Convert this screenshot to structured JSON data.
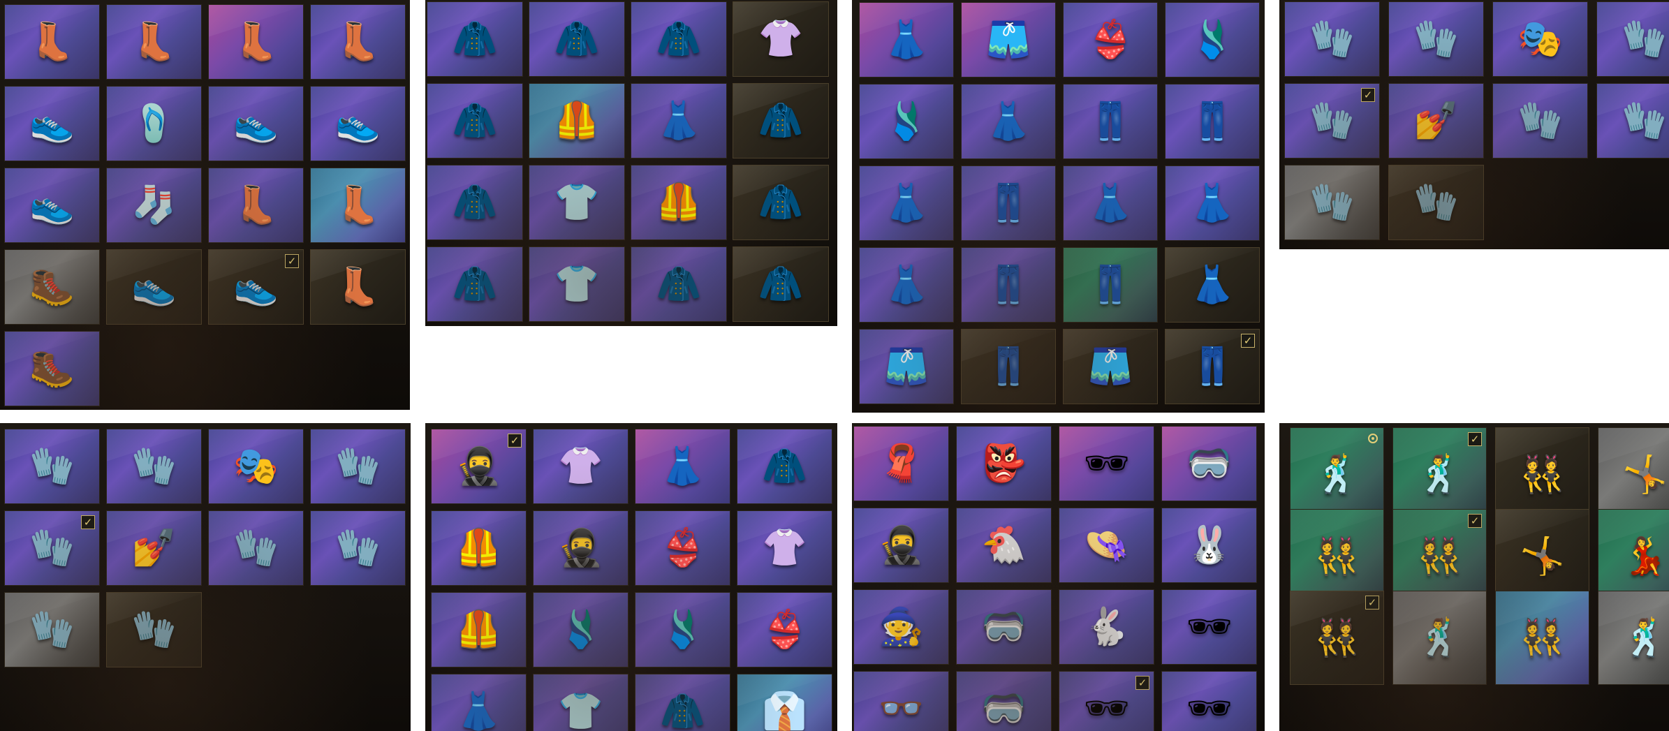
{
  "panels": [
    {
      "key": "shoes",
      "tiles": [
        {
          "icon": "boots-icon",
          "glyph": "👢",
          "bg": "purple"
        },
        {
          "icon": "boots-icon",
          "glyph": "👢",
          "bg": "purple"
        },
        {
          "icon": "thigh-high-boots-icon",
          "glyph": "👢",
          "bg": "pink"
        },
        {
          "icon": "boots-icon",
          "glyph": "👢",
          "bg": "purple"
        },
        {
          "icon": "sneakers-icon",
          "glyph": "👟",
          "bg": "purple"
        },
        {
          "icon": "sandals-icon",
          "glyph": "🩴",
          "bg": "purple"
        },
        {
          "icon": "sneakers-icon",
          "glyph": "👟",
          "bg": "purple"
        },
        {
          "icon": "sneakers-icon",
          "glyph": "👟",
          "bg": "purple"
        },
        {
          "icon": "sneakers-icon",
          "glyph": "👟",
          "bg": "purple"
        },
        {
          "icon": "checkered-socks-icon",
          "glyph": "🧦",
          "bg": "purple"
        },
        {
          "icon": "tall-boots-icon",
          "glyph": "👢",
          "bg": "purple"
        },
        {
          "icon": "tall-boots-icon",
          "glyph": "👢",
          "bg": "blue"
        },
        {
          "icon": "desert-boots-icon",
          "glyph": "🥾",
          "bg": "grey"
        },
        {
          "icon": "sneakers-icon",
          "glyph": "👟",
          "bg": "dark"
        },
        {
          "icon": "sneakers-icon",
          "glyph": "👟",
          "bg": "dark",
          "checked": true
        },
        {
          "icon": "fur-boots-icon",
          "glyph": "👢",
          "bg": "dark"
        },
        {
          "icon": "combat-boots-icon",
          "glyph": "🥾",
          "bg": "purple"
        }
      ]
    },
    {
      "key": "tops",
      "tiles": [
        {
          "icon": "hoodie-icon",
          "glyph": "🧥",
          "bg": "purple"
        },
        {
          "icon": "hoodie-icon",
          "glyph": "🧥",
          "bg": "purple"
        },
        {
          "icon": "jacket-icon",
          "glyph": "🧥",
          "bg": "purple"
        },
        {
          "icon": "sweater-icon",
          "glyph": "👚",
          "bg": "dark"
        },
        {
          "icon": "leather-jacket-icon",
          "glyph": "🧥",
          "bg": "purple"
        },
        {
          "icon": "vest-icon",
          "glyph": "🦺",
          "bg": "blue"
        },
        {
          "icon": "dress-icon",
          "glyph": "👗",
          "bg": "purple"
        },
        {
          "icon": "hoodie-icon",
          "glyph": "🧥",
          "bg": "dark"
        },
        {
          "icon": "long-coat-icon",
          "glyph": "🧥",
          "bg": "purple"
        },
        {
          "icon": "hoodie-icon",
          "glyph": "👕",
          "bg": "purple"
        },
        {
          "icon": "puffer-vest-icon",
          "glyph": "🦺",
          "bg": "purple"
        },
        {
          "icon": "jacket-icon",
          "glyph": "🧥",
          "bg": "dark"
        },
        {
          "icon": "hoodie-icon",
          "glyph": "🧥",
          "bg": "purple"
        },
        {
          "icon": "sweatshirt-icon",
          "glyph": "👕",
          "bg": "purple"
        },
        {
          "icon": "puffer-jacket-icon",
          "glyph": "🧥",
          "bg": "purple"
        },
        {
          "icon": "jacket-icon",
          "glyph": "🧥",
          "bg": "dark"
        }
      ]
    },
    {
      "key": "bottoms",
      "tiles": [
        {
          "icon": "dress-icon",
          "glyph": "👗",
          "bg": "pink"
        },
        {
          "icon": "skirt-icon",
          "glyph": "🩳",
          "bg": "pink"
        },
        {
          "icon": "outfit-icon",
          "glyph": "👙",
          "bg": "purple"
        },
        {
          "icon": "bodysuit-icon",
          "glyph": "🩱",
          "bg": "purple"
        },
        {
          "icon": "bodysuit-icon",
          "glyph": "🩱",
          "bg": "purple"
        },
        {
          "icon": "dress-icon",
          "glyph": "👗",
          "bg": "purple"
        },
        {
          "icon": "pants-icon",
          "glyph": "👖",
          "bg": "purple"
        },
        {
          "icon": "pants-icon",
          "glyph": "👖",
          "bg": "purple"
        },
        {
          "icon": "skirt-icon",
          "glyph": "👗",
          "bg": "purple"
        },
        {
          "icon": "pants-icon",
          "glyph": "👖",
          "bg": "purple"
        },
        {
          "icon": "plaid-skirt-icon",
          "glyph": "👗",
          "bg": "purple"
        },
        {
          "icon": "pleated-skirt-icon",
          "glyph": "👗",
          "bg": "purple"
        },
        {
          "icon": "skirt-icon",
          "glyph": "👗",
          "bg": "purple"
        },
        {
          "icon": "pants-icon",
          "glyph": "👖",
          "bg": "purple"
        },
        {
          "icon": "camo-pants-icon",
          "glyph": "👖",
          "bg": "green"
        },
        {
          "icon": "dress-icon",
          "glyph": "👗",
          "bg": "dark"
        },
        {
          "icon": "shorts-icon",
          "glyph": "🩳",
          "bg": "purple"
        },
        {
          "icon": "pants-icon",
          "glyph": "👖",
          "bg": "dark"
        },
        {
          "icon": "skirt-icon",
          "glyph": "🩳",
          "bg": "dark"
        },
        {
          "icon": "pants-icon",
          "glyph": "👖",
          "bg": "dark",
          "checked": true
        }
      ]
    },
    {
      "key": "gloves-top",
      "tiles": [
        {
          "icon": "glove-icon",
          "glyph": "🧤",
          "bg": "purple"
        },
        {
          "icon": "glove-icon",
          "glyph": "🧤",
          "bg": "purple"
        },
        {
          "icon": "mask-icon",
          "glyph": "🎭",
          "bg": "purple"
        },
        {
          "icon": "glove-icon",
          "glyph": "🧤",
          "bg": "purple"
        },
        {
          "icon": "glove-icon",
          "glyph": "🧤",
          "bg": "purple",
          "checked": true
        },
        {
          "icon": "nail-art-icon",
          "glyph": "💅",
          "bg": "purple"
        },
        {
          "icon": "glove-icon",
          "glyph": "🧤",
          "bg": "purple"
        },
        {
          "icon": "wrist-guard-icon",
          "glyph": "🧤",
          "bg": "purple"
        },
        {
          "icon": "fingerless-glove-icon",
          "glyph": "🧤",
          "bg": "grey"
        },
        {
          "icon": "racing-glove-icon",
          "glyph": "🧤",
          "bg": "dark"
        }
      ]
    },
    {
      "key": "gloves-bottom",
      "tiles": [
        {
          "icon": "glove-icon",
          "glyph": "🧤",
          "bg": "purple"
        },
        {
          "icon": "glove-icon",
          "glyph": "🧤",
          "bg": "purple"
        },
        {
          "icon": "mask-icon",
          "glyph": "🎭",
          "bg": "purple"
        },
        {
          "icon": "glove-icon",
          "glyph": "🧤",
          "bg": "purple"
        },
        {
          "icon": "glove-icon",
          "glyph": "🧤",
          "bg": "purple",
          "checked": true
        },
        {
          "icon": "nail-art-icon",
          "glyph": "💅",
          "bg": "purple"
        },
        {
          "icon": "glove-icon",
          "glyph": "🧤",
          "bg": "purple"
        },
        {
          "icon": "wrist-guard-icon",
          "glyph": "🧤",
          "bg": "purple"
        },
        {
          "icon": "fingerless-glove-icon",
          "glyph": "🧤",
          "bg": "grey"
        },
        {
          "icon": "racing-glove-icon",
          "glyph": "🧤",
          "bg": "dark"
        }
      ]
    },
    {
      "key": "outfits",
      "tiles": [
        {
          "icon": "outfit-icon",
          "glyph": "🥷",
          "bg": "pink",
          "checked": true
        },
        {
          "icon": "crop-top-icon",
          "glyph": "👚",
          "bg": "purple"
        },
        {
          "icon": "dress-icon",
          "glyph": "👗",
          "bg": "pink"
        },
        {
          "icon": "jacket-icon",
          "glyph": "🧥",
          "bg": "purple"
        },
        {
          "icon": "tactical-vest-icon",
          "glyph": "🦺",
          "bg": "purple"
        },
        {
          "icon": "ninja-top-icon",
          "glyph": "🥷",
          "bg": "purple"
        },
        {
          "icon": "outfit-icon",
          "glyph": "👙",
          "bg": "purple"
        },
        {
          "icon": "tank-top-icon",
          "glyph": "👚",
          "bg": "purple"
        },
        {
          "icon": "puffer-vest-icon",
          "glyph": "🦺",
          "bg": "purple"
        },
        {
          "icon": "bodysuit-icon",
          "glyph": "🩱",
          "bg": "purple"
        },
        {
          "icon": "bodysuit-icon",
          "glyph": "🩱",
          "bg": "purple"
        },
        {
          "icon": "bikini-icon",
          "glyph": "👙",
          "bg": "purple"
        },
        {
          "icon": "dress-icon",
          "glyph": "👗",
          "bg": "purple"
        },
        {
          "icon": "shirt-icon",
          "glyph": "👕",
          "bg": "purple"
        },
        {
          "icon": "hoodie-icon",
          "glyph": "🧥",
          "bg": "purple"
        },
        {
          "icon": "shirt-icon",
          "glyph": "👔",
          "bg": "blue"
        }
      ]
    },
    {
      "key": "headwear",
      "tiles": [
        {
          "icon": "bandana-icon",
          "glyph": "🧣",
          "bg": "pink"
        },
        {
          "icon": "luchador-mask-icon",
          "glyph": "👺",
          "bg": "purple"
        },
        {
          "icon": "sunglasses-icon",
          "glyph": "🕶",
          "bg": "pink"
        },
        {
          "icon": "visor-glasses-icon",
          "glyph": "🥽",
          "bg": "pink"
        },
        {
          "icon": "ninja-mask-icon",
          "glyph": "🥷",
          "bg": "purple"
        },
        {
          "icon": "chicken-mask-icon",
          "glyph": "🐔",
          "bg": "purple"
        },
        {
          "icon": "sun-hat-icon",
          "glyph": "👒",
          "bg": "purple"
        },
        {
          "icon": "bunny-mask-icon",
          "glyph": "🐰",
          "bg": "purple"
        },
        {
          "icon": "hood-icon",
          "glyph": "🧙",
          "bg": "purple"
        },
        {
          "icon": "goggles-icon",
          "glyph": "🥽",
          "bg": "purple"
        },
        {
          "icon": "gas-mask-icon",
          "glyph": "🐇",
          "bg": "purple"
        },
        {
          "icon": "sunglasses-icon",
          "glyph": "🕶",
          "bg": "purple"
        },
        {
          "icon": "glasses-icon",
          "glyph": "👓",
          "bg": "purple"
        },
        {
          "icon": "visor-glasses-icon",
          "glyph": "🥽",
          "bg": "purple"
        },
        {
          "icon": "visor-glasses-icon",
          "glyph": "🕶",
          "bg": "purple",
          "checked": true
        },
        {
          "icon": "sunglasses-icon",
          "glyph": "🕶",
          "bg": "purple"
        }
      ]
    },
    {
      "key": "emotes",
      "tiles": [
        {
          "icon": "dance-emote-icon",
          "glyph": "🕺",
          "bg": "green",
          "badge": "dot"
        },
        {
          "icon": "dance-emote-icon",
          "glyph": "🕺",
          "bg": "green",
          "checked": true
        },
        {
          "icon": "dance-emote-icon",
          "glyph": "👯",
          "bg": "dark"
        },
        {
          "icon": "breakdance-emote-icon",
          "glyph": "🤸",
          "bg": "grey"
        },
        {
          "icon": "dance-emote-icon",
          "glyph": "👯",
          "bg": "green"
        },
        {
          "icon": "dance-emote-icon",
          "glyph": "👯",
          "bg": "green",
          "checked": true
        },
        {
          "icon": "breakdance-emote-icon",
          "glyph": "🤸",
          "bg": "dark"
        },
        {
          "icon": "dance-emote-icon",
          "glyph": "💃",
          "bg": "green",
          "checked": true
        },
        {
          "icon": "dance-emote-icon",
          "glyph": "👯",
          "bg": "dark",
          "checked": true
        },
        {
          "icon": "dance-emote-icon",
          "glyph": "🕺",
          "bg": "grey"
        },
        {
          "icon": "dance-emote-icon",
          "glyph": "👯",
          "bg": "blue"
        },
        {
          "icon": "dance-emote-icon",
          "glyph": "🕺",
          "bg": "grey"
        }
      ]
    }
  ],
  "check_glyph": "✓"
}
